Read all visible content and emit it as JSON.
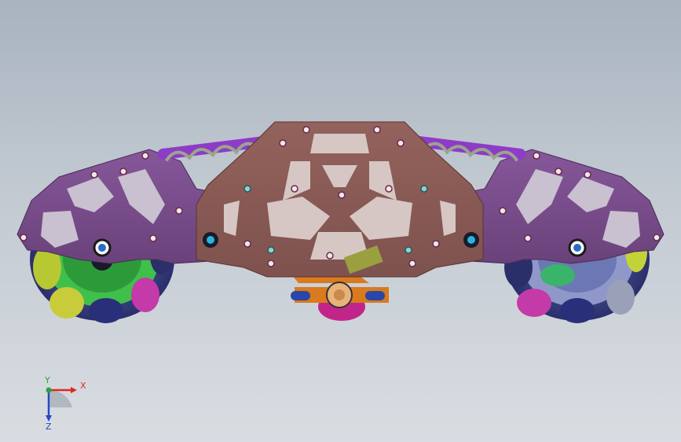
{
  "viewport": {
    "background_top": "#a8b3bf",
    "background_bottom": "#d9dde2"
  },
  "model": {
    "chassis_color": "#7a4f8a",
    "center_plate_color": "#8a5a56",
    "bracket_color": "#d97a1e",
    "spring_color": "#9aa58a",
    "shock_color": "#a23fd0",
    "hub_color": "#3ab46a",
    "roller_colors": [
      "#c4d23a",
      "#2a2f7a",
      "#c43aa8",
      "#d6a2c6",
      "#2e8a4a"
    ]
  },
  "triad": {
    "x_label": "X",
    "y_label": "Y",
    "z_label": "Z",
    "x_color": "#e0271f",
    "y_color": "#22a83a",
    "z_color": "#2a46c8"
  }
}
